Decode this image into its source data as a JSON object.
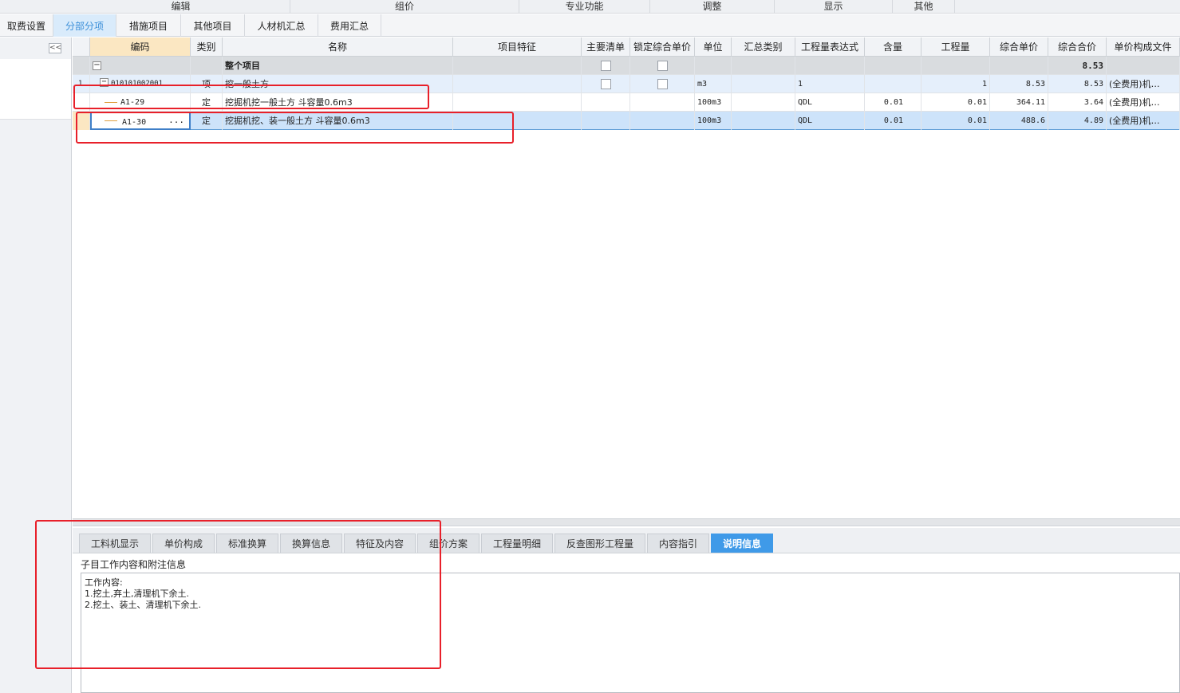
{
  "ribbon": [
    "编辑",
    "组价",
    "专业功能",
    "调整",
    "显示",
    "其他"
  ],
  "top_tabs": [
    {
      "label": "取费设置",
      "active": false
    },
    {
      "label": "分部分项",
      "active": true
    },
    {
      "label": "措施项目",
      "active": false
    },
    {
      "label": "其他项目",
      "active": false
    },
    {
      "label": "人材机汇总",
      "active": false
    },
    {
      "label": "费用汇总",
      "active": false
    }
  ],
  "left_panel": {
    "collapse_glyph": "<<"
  },
  "grid": {
    "headers": [
      "编码",
      "类别",
      "名称",
      "项目特征",
      "主要清单",
      "锁定综合单价",
      "单位",
      "汇总类别",
      "工程量表达式",
      "含量",
      "工程量",
      "综合单价",
      "综合合价",
      "单价构成文件"
    ],
    "rows": [
      {
        "kind": "total",
        "tree_glyph": "−",
        "code": "",
        "type": "",
        "name": "整个项目",
        "main": "checkbox",
        "lock": "checkbox",
        "total": "8.53"
      },
      {
        "kind": "item",
        "index": "1",
        "tree_glyph": "−",
        "code": "010101002001",
        "type": "项",
        "name": "挖一般土方",
        "unit": "m3",
        "expr": "1",
        "qty": "1",
        "price": "8.53",
        "total": "8.53",
        "file": "(全费用)机…"
      },
      {
        "kind": "sub",
        "code": "A1-29",
        "type": "定",
        "name": "挖掘机挖一般土方 斗容量0.6m3",
        "unit": "100m3",
        "expr": "QDL",
        "content": "0.01",
        "qty": "0.01",
        "price": "364.11",
        "total": "3.64",
        "file": "(全费用)机…"
      },
      {
        "kind": "sub-selected",
        "code": "A1-30",
        "ellipsis": "···",
        "type": "定",
        "name": "挖掘机挖、装一般土方 斗容量0.6m3",
        "unit": "100m3",
        "expr": "QDL",
        "content": "0.01",
        "qty": "0.01",
        "price": "488.6",
        "total": "4.89",
        "file": "(全费用)机…"
      }
    ]
  },
  "bottom_tabs": [
    {
      "label": "工料机显示",
      "active": false
    },
    {
      "label": "单价构成",
      "active": false
    },
    {
      "label": "标准换算",
      "active": false
    },
    {
      "label": "换算信息",
      "active": false
    },
    {
      "label": "特征及内容",
      "active": false
    },
    {
      "label": "组价方案",
      "active": false
    },
    {
      "label": "工程量明细",
      "active": false
    },
    {
      "label": "反查图形工程量",
      "active": false
    },
    {
      "label": "内容指引",
      "active": false
    },
    {
      "label": "说明信息",
      "active": true
    }
  ],
  "info": {
    "title": "子目工作内容和附注信息",
    "text": "工作内容:\n1.挖土,弃土,清理机下余土.\n2.挖土、装土、清理机下余土."
  },
  "colors": {
    "active_tab": "#3f9ae8",
    "selected_row": "#cde3fa",
    "item_row": "#e5effb",
    "annotation": "#e8202a"
  }
}
